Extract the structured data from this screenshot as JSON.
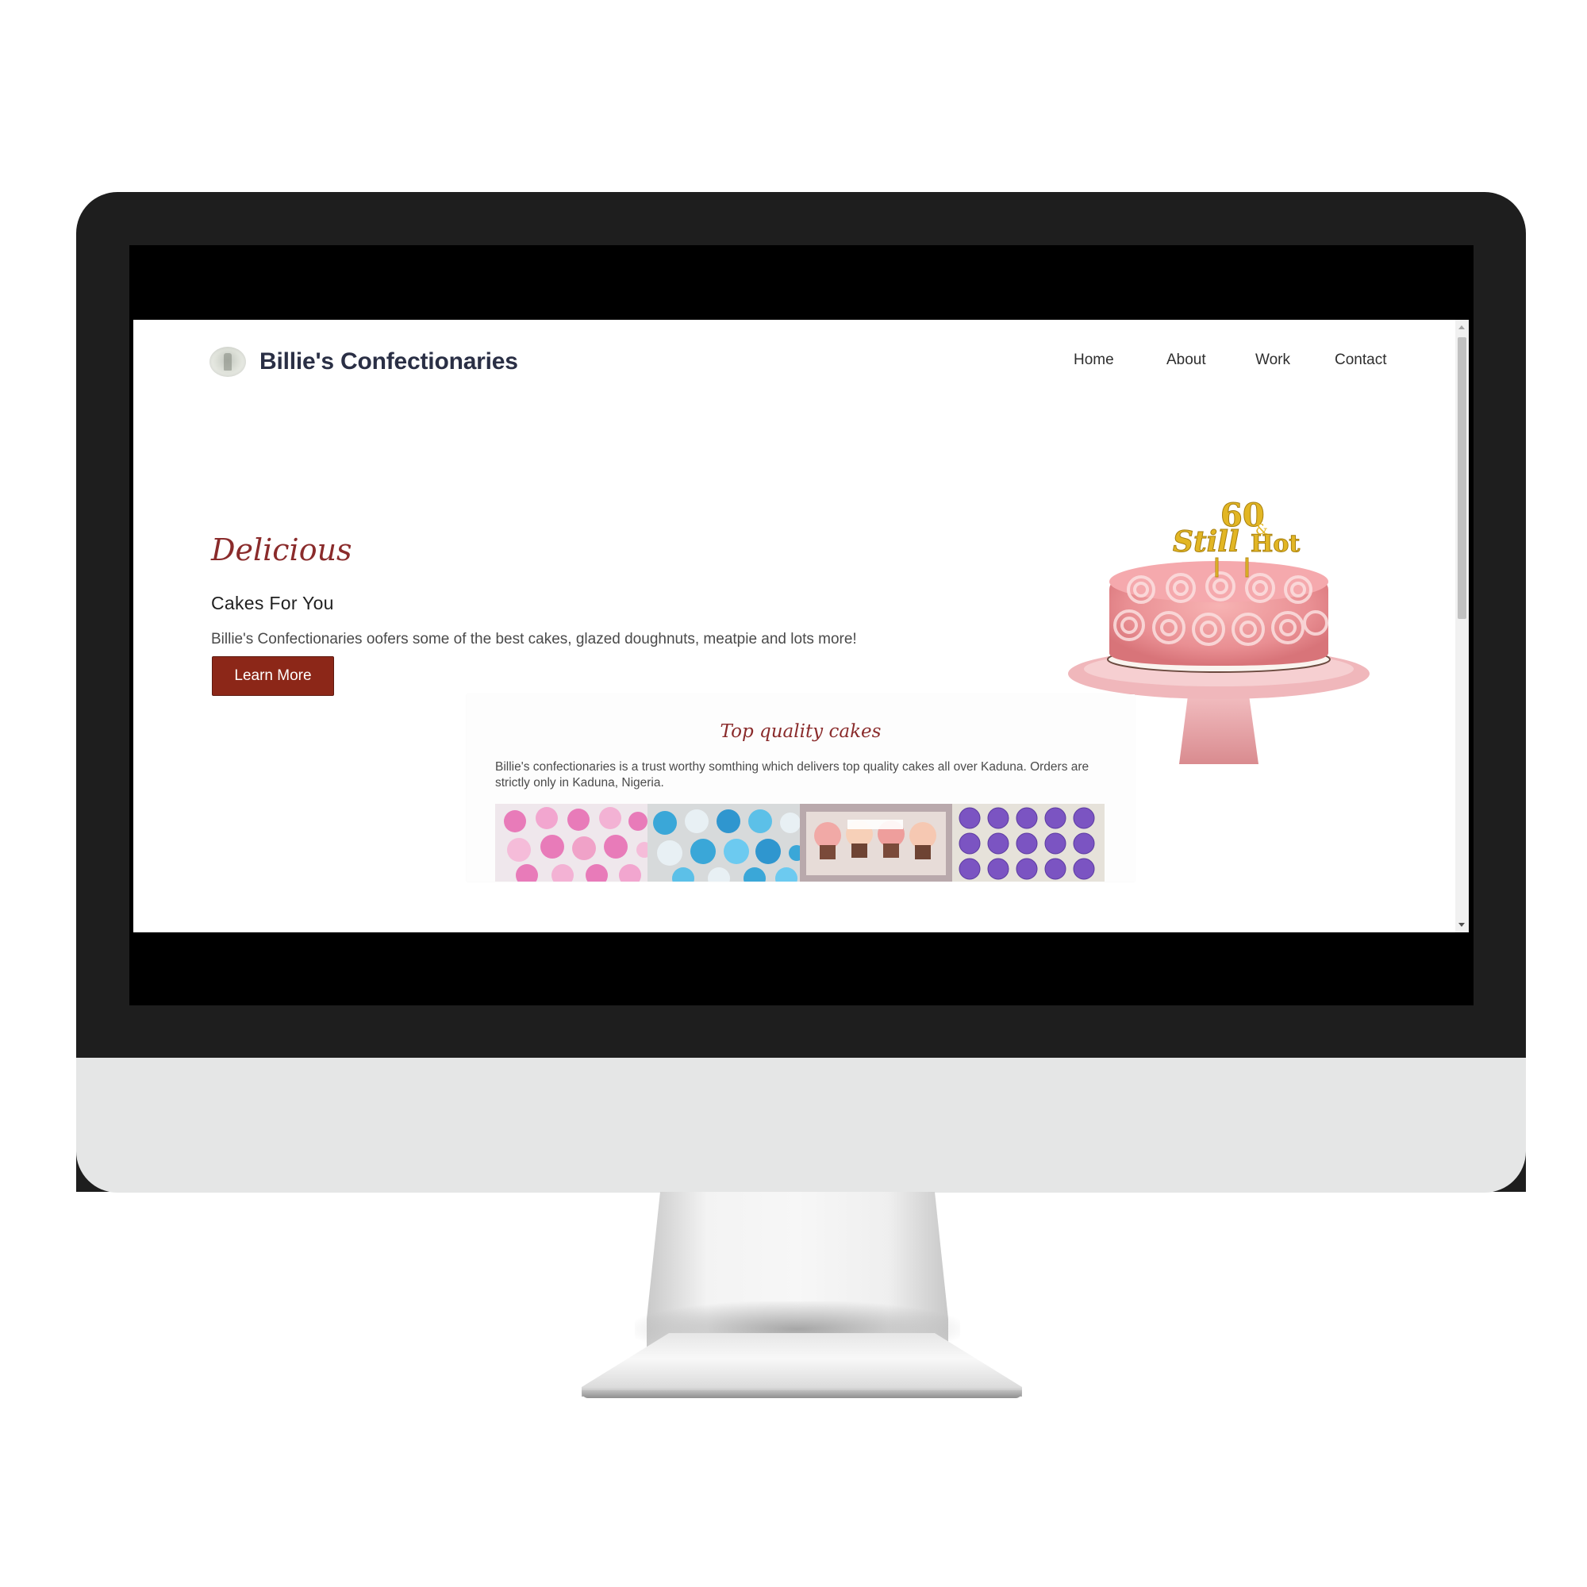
{
  "site": {
    "brand": "Billie's Confectionaries",
    "nav": [
      "Home",
      "About",
      "Work",
      "Contact"
    ]
  },
  "hero": {
    "script_heading": "Delicious",
    "title": "Cakes For You",
    "description": "Billie's Confectionaries oofers some of the best cakes, glazed doughnuts, meatpie and lots more!",
    "button_label": "Learn More",
    "cake_topper_text": "60 & still Hot"
  },
  "quality": {
    "heading": "Top quality cakes",
    "description": "Billie's confectionaries is a trust worthy somthing which delivers top quality cakes all over Kaduna. Orders are strictly only in Kaduna, Nigeria."
  },
  "colors": {
    "accent": "#8a2b2b",
    "button": "#8c2718",
    "brand_text": "#2a2f45",
    "monitor_bezel": "#1e1e1e",
    "monitor_chin": "#e5e6e6"
  },
  "icons": [
    "logo-icon",
    "scroll-up-icon",
    "scroll-down-icon"
  ]
}
